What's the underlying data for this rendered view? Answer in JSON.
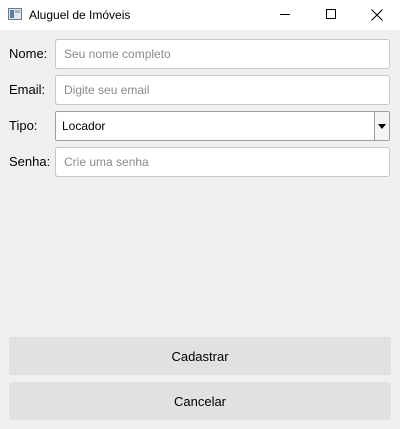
{
  "window": {
    "title": "Aluguel de Imóveis",
    "icon": "app-window-icon"
  },
  "form": {
    "nome": {
      "label": "Nome:",
      "value": "",
      "placeholder": "Seu nome completo"
    },
    "email": {
      "label": "Email:",
      "value": "",
      "placeholder": "Digite seu email"
    },
    "tipo": {
      "label": "Tipo:",
      "selected": "Locador"
    },
    "senha": {
      "label": "Senha:",
      "value": "",
      "placeholder": "Crie uma senha"
    }
  },
  "actions": {
    "cadastrar": "Cadastrar",
    "cancelar": "Cancelar"
  }
}
